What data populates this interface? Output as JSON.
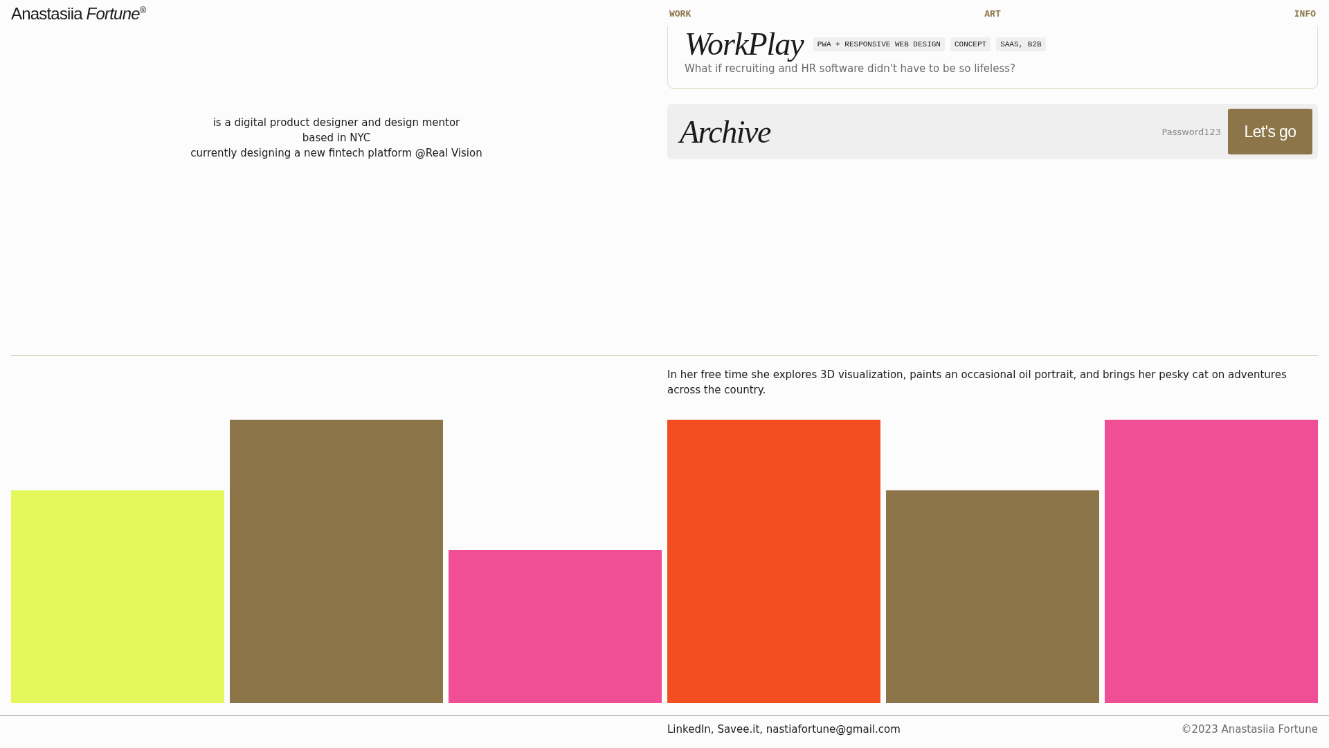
{
  "header": {
    "logo": "Anastasiia *Fortune*$^{®}$",
    "nav": [
      {
        "label": "WORK"
      },
      {
        "label": "ART"
      },
      {
        "label": "INFO"
      }
    ]
  },
  "intro": [
    "is a digital product designer and design mentor",
    "based in NYC",
    "currently designing a new fintech platform @Real Vision"
  ],
  "project": {
    "title": "WorkPlay",
    "tags": [
      "PWA + RESPONSIVE WEB DESIGN",
      "CONCEPT",
      "SAAS, B2B"
    ],
    "description": "What if recruiting and HR software didn't have to be so lifeless?"
  },
  "archive": {
    "title": "Archive",
    "password": {
      "placeholder": "Password123"
    },
    "button": "Let's go"
  },
  "free_time": "In her free time she explores 3D visualization, paints an occasional oil portrait, and brings her pesky cat on adventures across the country.",
  "tiles": [
    {
      "kind": "medium",
      "color": "#e4f75b"
    },
    {
      "kind": "tall",
      "color": "#8c7649"
    },
    {
      "kind": "short",
      "color": "#f04e95"
    },
    {
      "kind": "tall",
      "color": "#f24e22"
    },
    {
      "kind": "medium",
      "color": "#8c7649"
    },
    {
      "kind": "tall",
      "color": "#f04e95"
    }
  ],
  "footer": {
    "links": "LinkedIn, Savee.it, nastiafortune@gmail.com",
    "copyright": "©2023 Anastasiia Fortune"
  }
}
